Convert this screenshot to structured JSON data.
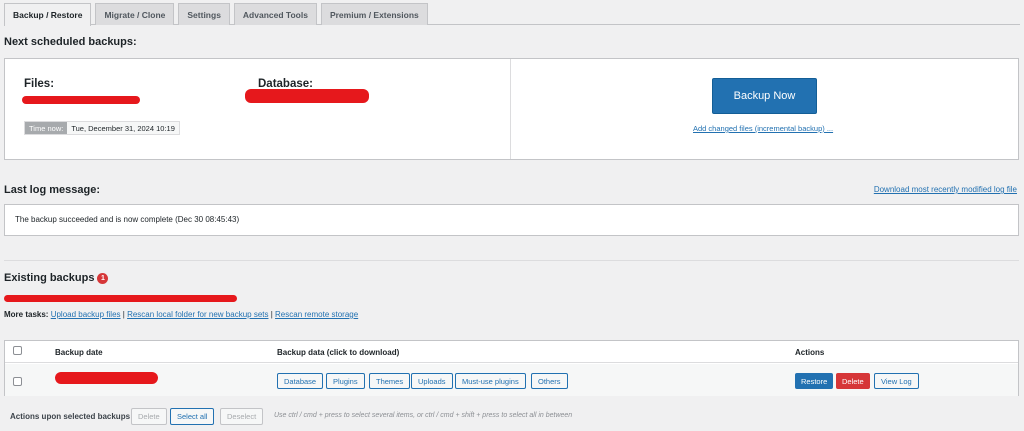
{
  "tabs": [
    {
      "label": "Backup / Restore",
      "active": true
    },
    {
      "label": "Migrate / Clone"
    },
    {
      "label": "Settings"
    },
    {
      "label": "Advanced Tools"
    },
    {
      "label": "Premium / Extensions"
    }
  ],
  "scheduled": {
    "heading": "Next scheduled backups:",
    "files_label": "Files:",
    "database_label": "Database:",
    "time_now_label": "Time now:",
    "time_now_value": "Tue, December 31, 2024 10:19",
    "backup_now_label": "Backup Now",
    "incremental_link": "Add changed files (incremental backup) ..."
  },
  "log": {
    "heading": "Last log message:",
    "download_link": "Download most recently modified log file",
    "message": "The backup succeeded and is now complete (Dec 30 08:45:43)"
  },
  "existing": {
    "heading": "Existing backups",
    "count": "1",
    "more_tasks_label": "More tasks:",
    "upload_link": "Upload backup files",
    "rescan_local_link": "Rescan local folder for new backup sets",
    "rescan_remote_link": "Rescan remote storage",
    "separator": "|"
  },
  "table": {
    "col_date": "Backup date",
    "col_data": "Backup data (click to download)",
    "col_actions": "Actions",
    "data_buttons": [
      "Database",
      "Plugins",
      "Themes",
      "Uploads",
      "Must-use plugins",
      "Others"
    ],
    "restore_label": "Restore",
    "delete_label": "Delete",
    "view_log_label": "View Log"
  },
  "footer": {
    "label": "Actions upon selected backups",
    "delete_label": "Delete",
    "select_all_label": "Select all",
    "deselect_label": "Deselect",
    "hint": "Use ctrl / cmd + press to select several items, or ctrl / cmd + shift + press to select all in between"
  },
  "colors": {
    "primary": "#2271b1",
    "danger": "#d63638",
    "redaction": "#e6181c"
  }
}
